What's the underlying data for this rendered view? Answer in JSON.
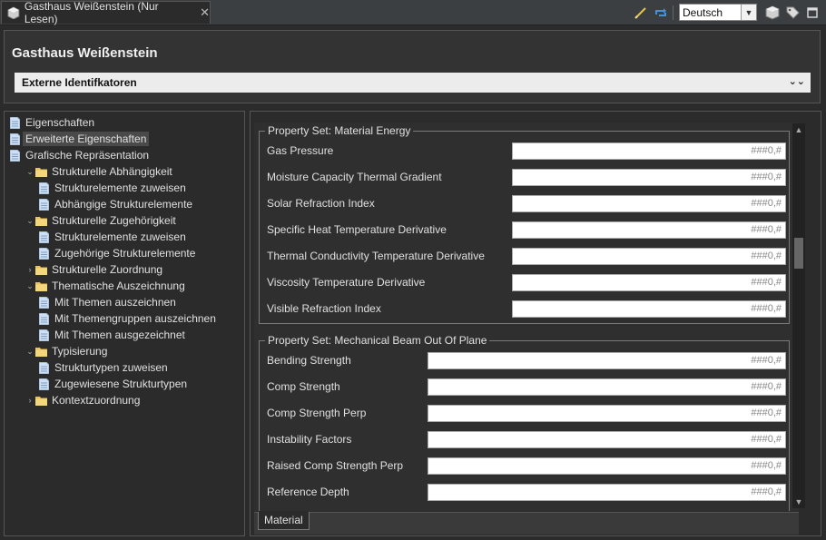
{
  "tab": {
    "title": "Gasthaus Weißenstein (Nur Lesen)",
    "close": "✕"
  },
  "toolbar": {
    "language": "Deutsch"
  },
  "header": {
    "title": "Gasthaus Weißenstein",
    "section": "Externe Identifkatoren"
  },
  "tree": [
    {
      "label": "Eigenschaften",
      "level": 1,
      "kind": "doc"
    },
    {
      "label": "Erweiterte Eigenschaften",
      "level": 1,
      "kind": "doc",
      "selected": true
    },
    {
      "label": "Grafische Repräsentation",
      "level": 1,
      "kind": "doc"
    },
    {
      "label": "Strukturelle Abhängigkeit",
      "level": 0,
      "kind": "folder",
      "expanded": true
    },
    {
      "label": "Strukturelemente zuweisen",
      "level": 2,
      "kind": "doc"
    },
    {
      "label": "Abhängige Strukturelemente",
      "level": 2,
      "kind": "doc"
    },
    {
      "label": "Strukturelle Zugehörigkeit",
      "level": 0,
      "kind": "folder",
      "expanded": true
    },
    {
      "label": "Strukturelemente zuweisen",
      "level": 2,
      "kind": "doc"
    },
    {
      "label": "Zugehörige Strukturelemente",
      "level": 2,
      "kind": "doc"
    },
    {
      "label": "Strukturelle Zuordnung",
      "level": 0,
      "kind": "folder",
      "expanded": false
    },
    {
      "label": "Thematische Auszeichnung",
      "level": 0,
      "kind": "folder",
      "expanded": true
    },
    {
      "label": "Mit Themen auszeichnen",
      "level": 2,
      "kind": "doc"
    },
    {
      "label": "Mit Themengruppen auszeichnen",
      "level": 2,
      "kind": "doc"
    },
    {
      "label": "Mit Themen ausgezeichnet",
      "level": 2,
      "kind": "doc"
    },
    {
      "label": "Typisierung",
      "level": 0,
      "kind": "folder",
      "expanded": true
    },
    {
      "label": "Strukturtypen zuweisen",
      "level": 2,
      "kind": "doc"
    },
    {
      "label": "Zugewiesene Strukturtypen",
      "level": 2,
      "kind": "doc"
    },
    {
      "label": "Kontextzuordnung",
      "level": 0,
      "kind": "folder",
      "expanded": false
    }
  ],
  "groups": [
    {
      "title": "Property Set: Material Energy",
      "rows": [
        {
          "label": "Gas Pressure",
          "value": "###0,#"
        },
        {
          "label": "Moisture Capacity Thermal Gradient",
          "value": "###0,#"
        },
        {
          "label": "Solar Refraction Index",
          "value": "###0,#"
        },
        {
          "label": "Specific Heat Temperature Derivative",
          "value": "###0,#"
        },
        {
          "label": "Thermal Conductivity Temperature Derivative",
          "value": "###0,#"
        },
        {
          "label": "Viscosity Temperature Derivative",
          "value": "###0,#"
        },
        {
          "label": "Visible Refraction Index",
          "value": "###0,#"
        }
      ]
    },
    {
      "title": "Property Set: Mechanical Beam Out Of Plane",
      "rows": [
        {
          "label": "Bending Strength",
          "value": "###0,#"
        },
        {
          "label": "Comp Strength",
          "value": "###0,#"
        },
        {
          "label": "Comp Strength Perp",
          "value": "###0,#"
        },
        {
          "label": "Instability Factors",
          "value": "###0,#"
        },
        {
          "label": "Raised Comp Strength Perp",
          "value": "###0,#"
        },
        {
          "label": "Reference Depth",
          "value": "###0,#"
        }
      ]
    }
  ],
  "bottom_tab": "Material",
  "colors": {
    "folder": "#e8c45a",
    "doc": "#cfe0f4",
    "accent": "#4a90d9"
  },
  "icons": [
    "building-icon",
    "pencil-icon",
    "sync-icon",
    "chevron-down-icon",
    "cube-icon",
    "tag-icon",
    "maximize-icon",
    "folder-icon",
    "document-icon"
  ]
}
